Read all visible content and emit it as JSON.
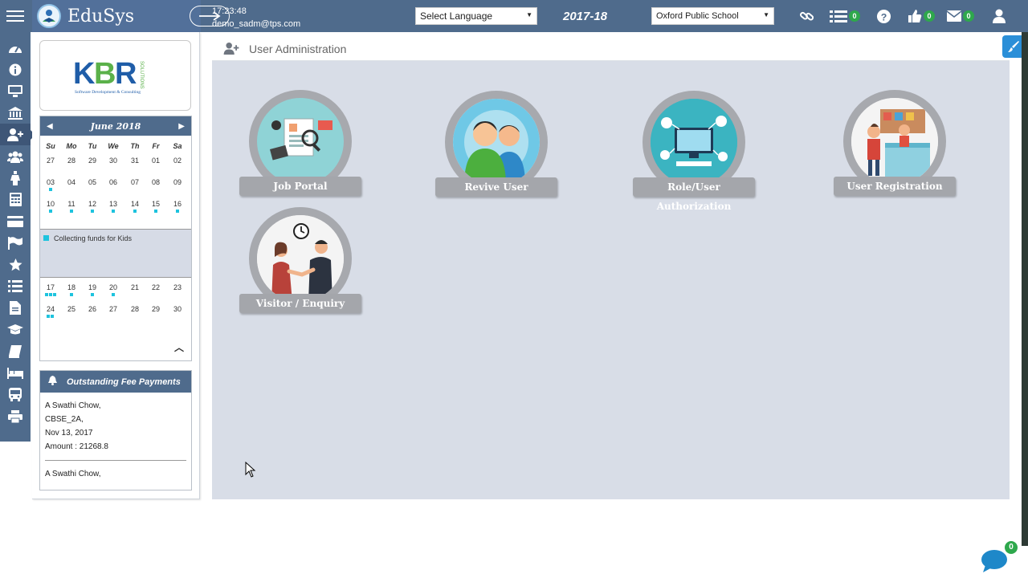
{
  "app": {
    "name": "EduSys"
  },
  "topbar": {
    "time": "17:23:48",
    "user_email": "demo_sadm@tps.com",
    "language_select": "Select Language",
    "academic_year": "2017-18",
    "school_select": "Oxford Public School",
    "badges": {
      "tasks": "0",
      "likes": "0",
      "messages": "0"
    }
  },
  "sidebar": {
    "icons": [
      "dashboard-icon",
      "info-icon",
      "monitor-icon",
      "bank-icon",
      "user-admin-icon",
      "users-group-icon",
      "hanger-icon",
      "calculator-icon",
      "card-icon",
      "flag-icon",
      "star-icon",
      "list-icon",
      "document-icon",
      "graduation-cap-icon",
      "book-icon",
      "bed-icon",
      "bus-icon",
      "print-icon"
    ],
    "active_index": 4
  },
  "widgets": {
    "logo_text": "KBR",
    "logo_tagline": "Software Development & Consulting",
    "logo_side": "SOLUTIONS",
    "calendar": {
      "month_label": "June 2018",
      "weekdays": [
        "Su",
        "Mo",
        "Tu",
        "We",
        "Th",
        "Fr",
        "Sa"
      ],
      "weeks": [
        [
          "27",
          "28",
          "29",
          "30",
          "31",
          "01",
          "02"
        ],
        [
          "03",
          "04",
          "05",
          "06",
          "07",
          "08",
          "09"
        ],
        [
          "10",
          "11",
          "12",
          "13",
          "14",
          "15",
          "16"
        ],
        [
          "17",
          "18",
          "19",
          "20",
          "21",
          "22",
          "23"
        ],
        [
          "24",
          "25",
          "26",
          "27",
          "28",
          "29",
          "30"
        ]
      ],
      "event_text": "Collecting funds for Kids"
    },
    "fee_panel": {
      "title": "Outstanding Fee Payments",
      "entries": [
        {
          "name": "A Swathi Chow,",
          "class": "CBSE_2A,",
          "date": "Nov 13, 2017",
          "amount": "Amount : 21268.8"
        },
        {
          "name": "A Swathi Chow,"
        }
      ]
    }
  },
  "main": {
    "title": "User Administration",
    "tiles": [
      {
        "label": "Job Portal"
      },
      {
        "label": "Revive User"
      },
      {
        "label": "Role/User Authorization"
      },
      {
        "label": "User Registration"
      },
      {
        "label": "Visitor / Enquiry"
      }
    ]
  },
  "floating": {
    "chat_badge": "0"
  },
  "colors": {
    "topbar": "#4f6b8c",
    "panel_bg": "#d8dde7",
    "badge_green": "#2ea84c",
    "event_cyan": "#1ec3de"
  }
}
